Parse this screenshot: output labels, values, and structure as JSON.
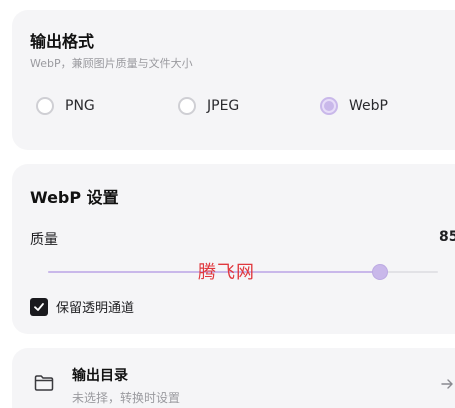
{
  "format_section": {
    "title": "输出格式",
    "subtitle": "WebP，兼顾图片质量与文件大小",
    "options": [
      {
        "label": "PNG",
        "selected": false
      },
      {
        "label": "JPEG",
        "selected": false
      },
      {
        "label": "WebP",
        "selected": true
      }
    ]
  },
  "webp_section": {
    "title": "WebP 设置",
    "quality_label": "质量",
    "quality_value": "85",
    "quality_slider": {
      "min": 0,
      "max": 100,
      "value": 85
    },
    "keep_transparency_label": "保留透明通道",
    "keep_transparency_checked": true
  },
  "watermark": "腾飞网",
  "output_section": {
    "title": "输出目录",
    "subtitle": "未选择，转换时设置"
  },
  "colors": {
    "accent": "#c9b8ea",
    "card_bg": "#f5f5f7",
    "watermark": "#e0383e"
  },
  "icons": {
    "folder": "folder-icon",
    "arrow": "arrow-right-icon",
    "check": "check-icon"
  }
}
